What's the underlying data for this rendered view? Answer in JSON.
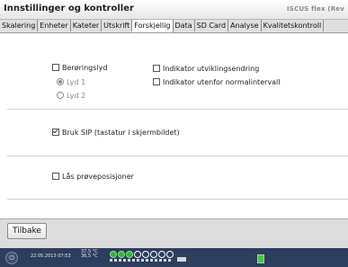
{
  "window": {
    "title": "Innstillinger og kontroller",
    "brand": "ISCUS flex (Rev"
  },
  "tabs": [
    {
      "label": "Skalering",
      "active": false
    },
    {
      "label": "Enheter",
      "active": false
    },
    {
      "label": "Kateter",
      "active": false
    },
    {
      "label": "Utskrift",
      "active": false
    },
    {
      "label": "Forskjellig",
      "active": true
    },
    {
      "label": "Data",
      "active": false
    },
    {
      "label": "SD Card",
      "active": false
    },
    {
      "label": "Analyse",
      "active": false
    },
    {
      "label": "Kvalitetskontroll",
      "active": false
    }
  ],
  "settings": {
    "beroringslyd": {
      "label": "Berøringslyd",
      "checked": false
    },
    "lyd1": {
      "label": "Lyd 1",
      "selected": true,
      "disabled": true
    },
    "lyd2": {
      "label": "Lyd 2",
      "selected": false,
      "disabled": true
    },
    "indikator_utvikling": {
      "label": "Indikator utviklingsendring",
      "checked": false
    },
    "indikator_normal": {
      "label": "Indikator utenfor normalintervall",
      "checked": false
    },
    "bruk_sip": {
      "label": "Bruk SIP (tastatur i skjermbildet)",
      "checked": true
    },
    "las_prove": {
      "label": "Lås prøveposisjoner",
      "checked": false
    }
  },
  "footer": {
    "back_label": "Tilbake"
  },
  "status": {
    "datetime": "22.05.2013 07:53",
    "temp1": "37,5 °C",
    "temp2": "36,5 °C"
  }
}
